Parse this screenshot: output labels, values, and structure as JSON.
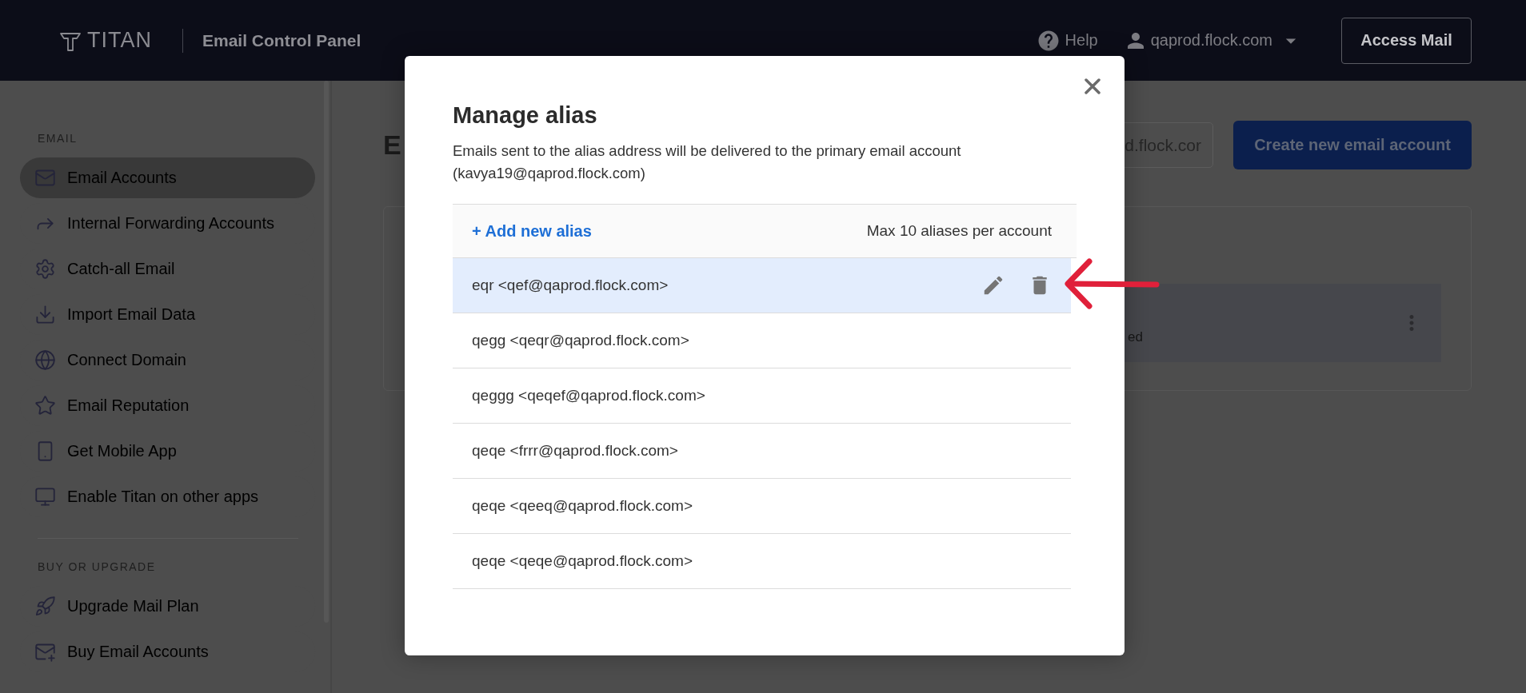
{
  "header": {
    "logo": "TITAN",
    "title": "Email Control Panel",
    "help": "Help",
    "account": "qaprod.flock.com",
    "access_button": "Access Mail"
  },
  "sidebar": {
    "sections": [
      {
        "heading": "EMAIL",
        "items": [
          {
            "label": "Email Accounts",
            "selected": true
          },
          {
            "label": "Internal Forwarding Accounts",
            "selected": false
          },
          {
            "label": "Catch-all Email",
            "selected": false
          },
          {
            "label": "Import Email Data",
            "selected": false
          },
          {
            "label": "Connect Domain",
            "selected": false
          },
          {
            "label": "Email Reputation",
            "selected": false
          },
          {
            "label": "Get Mobile App",
            "selected": false
          },
          {
            "label": "Enable Titan on other apps",
            "selected": false
          }
        ]
      },
      {
        "heading": "BUY OR UPGRADE",
        "items": [
          {
            "label": "Upgrade Mail Plan",
            "selected": false
          },
          {
            "label": "Buy Email Accounts",
            "selected": false
          }
        ]
      }
    ]
  },
  "main": {
    "heading": "E",
    "domain_select": "d.flock.cor",
    "create_button": "Create new email account",
    "row_text": "ed"
  },
  "modal": {
    "title": "Manage alias",
    "description": "Emails sent to the alias address will be delivered to the primary email account (kavya19@qaprod.flock.com)",
    "add_link": "+ Add new alias",
    "limit": "Max 10 aliases per account",
    "aliases": [
      {
        "text": "eqr <qef@qaprod.flock.com>",
        "hovered": true
      },
      {
        "text": "qegg <qeqr@qaprod.flock.com>",
        "hovered": false
      },
      {
        "text": "qeggg <qeqef@qaprod.flock.com>",
        "hovered": false
      },
      {
        "text": "qeqe <frrr@qaprod.flock.com>",
        "hovered": false
      },
      {
        "text": "qeqe <qeeq@qaprod.flock.com>",
        "hovered": false
      },
      {
        "text": "qeqe <qeqe@qaprod.flock.com>",
        "hovered": false
      }
    ]
  }
}
